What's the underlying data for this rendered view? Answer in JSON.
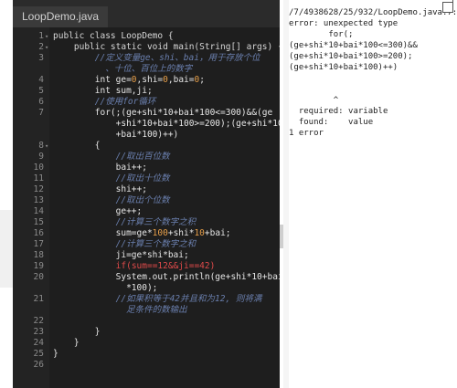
{
  "editor": {
    "tab_label": "LoopDemo.java",
    "lines": [
      {
        "n": "1",
        "fold": "▾",
        "parts": [
          {
            "t": "public class LoopDemo {",
            "c": "kw"
          }
        ]
      },
      {
        "n": "2",
        "fold": "▾",
        "parts": [
          {
            "t": "    public static void main(String[] args) {",
            "c": "kw"
          }
        ]
      },
      {
        "n": "3",
        "fold": "",
        "parts": [
          {
            "t": "        //定义变量ge、shi、bai，用于存放个位",
            "c": "cm"
          }
        ]
      },
      {
        "n": "",
        "fold": "",
        "parts": [
          {
            "t": "          、十位、百位上的数字",
            "c": "cm"
          }
        ]
      },
      {
        "n": "4",
        "fold": "",
        "parts": [
          {
            "t": "        int ge=",
            "c": ""
          },
          {
            "t": "0",
            "c": "num"
          },
          {
            "t": ",shi=",
            "c": ""
          },
          {
            "t": "0",
            "c": "num"
          },
          {
            "t": ",bai=",
            "c": ""
          },
          {
            "t": "0",
            "c": "num"
          },
          {
            "t": ";",
            "c": ""
          }
        ]
      },
      {
        "n": "5",
        "fold": "",
        "parts": [
          {
            "t": "        int sum,ji;",
            "c": ""
          }
        ]
      },
      {
        "n": "6",
        "fold": "",
        "parts": [
          {
            "t": "        //使用for循环",
            "c": "cm"
          }
        ]
      },
      {
        "n": "7",
        "fold": "",
        "parts": [
          {
            "t": "        for(;(ge+shi*10+bai*100<=300)&&(ge",
            "c": ""
          }
        ]
      },
      {
        "n": "",
        "fold": "",
        "parts": [
          {
            "t": "            +shi*10+bai*100>=200);(ge+shi*10",
            "c": ""
          }
        ]
      },
      {
        "n": "",
        "fold": "",
        "parts": [
          {
            "t": "            +bai*100)++)",
            "c": ""
          }
        ]
      },
      {
        "n": "8",
        "fold": "▾",
        "parts": [
          {
            "t": "        {",
            "c": ""
          }
        ]
      },
      {
        "n": "9",
        "fold": "",
        "parts": [
          {
            "t": "            //取出百位数",
            "c": "cm"
          }
        ]
      },
      {
        "n": "10",
        "fold": "",
        "parts": [
          {
            "t": "            bai++;",
            "c": ""
          }
        ]
      },
      {
        "n": "11",
        "fold": "",
        "parts": [
          {
            "t": "            //取出十位数",
            "c": "cm"
          }
        ]
      },
      {
        "n": "12",
        "fold": "",
        "parts": [
          {
            "t": "            shi++;",
            "c": ""
          }
        ]
      },
      {
        "n": "13",
        "fold": "",
        "parts": [
          {
            "t": "            //取出个位数",
            "c": "cm"
          }
        ]
      },
      {
        "n": "14",
        "fold": "",
        "parts": [
          {
            "t": "            ge++;",
            "c": ""
          }
        ]
      },
      {
        "n": "15",
        "fold": "",
        "parts": [
          {
            "t": "            //计算三个数字之积",
            "c": "cm"
          }
        ]
      },
      {
        "n": "16",
        "fold": "",
        "parts": [
          {
            "t": "            sum=ge*",
            "c": ""
          },
          {
            "t": "100",
            "c": "num"
          },
          {
            "t": "+shi*",
            "c": ""
          },
          {
            "t": "10",
            "c": "num"
          },
          {
            "t": "+bai;",
            "c": ""
          }
        ]
      },
      {
        "n": "17",
        "fold": "",
        "parts": [
          {
            "t": "            //计算三个数字之和",
            "c": "cm"
          }
        ]
      },
      {
        "n": "18",
        "fold": "",
        "parts": [
          {
            "t": "            ji=ge*shi*bai;",
            "c": ""
          }
        ]
      },
      {
        "n": "19",
        "fold": "",
        "parts": [
          {
            "t": "            ",
            "c": ""
          },
          {
            "t": "if",
            "c": "hl"
          },
          {
            "t": "(sum==12&&ji==42)",
            "c": "hl"
          }
        ]
      },
      {
        "n": "20",
        "fold": "",
        "parts": [
          {
            "t": "            System.out.println(ge+shi*10+bai",
            "c": ""
          }
        ]
      },
      {
        "n": "",
        "fold": "",
        "parts": [
          {
            "t": "              *100);",
            "c": ""
          }
        ]
      },
      {
        "n": "21",
        "fold": "",
        "parts": [
          {
            "t": "            //如果积等于42并且和为12, 则将满",
            "c": "cm"
          }
        ]
      },
      {
        "n": "",
        "fold": "",
        "parts": [
          {
            "t": "              足条件的数输出",
            "c": "cm"
          }
        ]
      },
      {
        "n": "22",
        "fold": "",
        "parts": [
          {
            "t": "",
            "c": ""
          }
        ]
      },
      {
        "n": "23",
        "fold": "",
        "parts": [
          {
            "t": "        }",
            "c": ""
          }
        ]
      },
      {
        "n": "24",
        "fold": "",
        "parts": [
          {
            "t": "    }",
            "c": ""
          }
        ]
      },
      {
        "n": "25",
        "fold": "",
        "parts": [
          {
            "t": "}",
            "c": ""
          }
        ]
      },
      {
        "n": "26",
        "fold": "",
        "parts": [
          {
            "t": "",
            "c": ""
          }
        ]
      }
    ]
  },
  "output": {
    "lines": [
      "/7/4938628/25/932/LoopDemo.java:7:",
      "error: unexpected type",
      "        for(;",
      "(ge+shi*10+bai*100<=300)&&",
      "(ge+shi*10+bai*100>=200);",
      "(ge+shi*10+bai*100)++)",
      "",
      "",
      "         ^",
      "  required: variable",
      "  found:    value",
      "1 error"
    ]
  }
}
